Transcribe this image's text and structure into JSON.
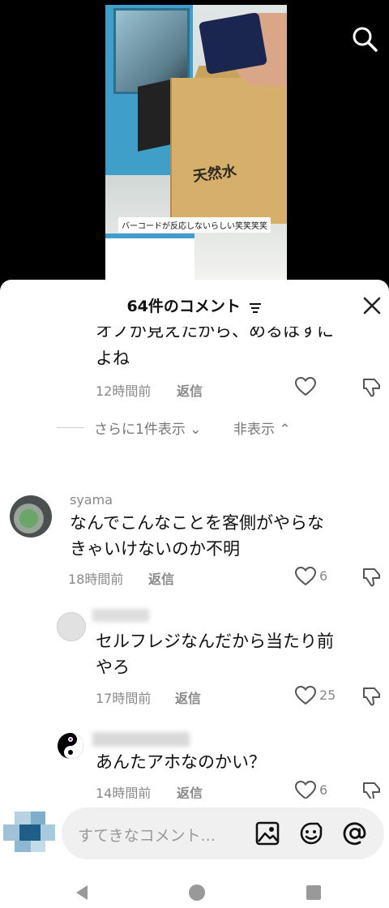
{
  "video": {
    "caption": "バーコードが反応しないらしい笑笑笑笑",
    "box_label": "天然水"
  },
  "sheet": {
    "title": "64件のコメント"
  },
  "comments": {
    "partial": {
      "text_line1": "オノが見えたから、めるはすに",
      "text_line2": "よね",
      "time": "12時間前",
      "reply": "返信"
    },
    "more": {
      "show_more": "さらに1件表示",
      "hide": "非表示"
    },
    "items": [
      {
        "username": "syama",
        "line1": "なんでこんなことを客側がやらな",
        "line2": "きゃいけないのか不明",
        "time": "18時間前",
        "reply": "返信",
        "likes": "6"
      },
      {
        "username": "",
        "line1": "セルフレジなんだから当たり前",
        "line2": "やろ",
        "time": "17時間前",
        "reply": "返信",
        "likes": "25"
      },
      {
        "username": "",
        "line1": "あんたアホなのかい？",
        "time": "14時間前",
        "reply": "返信",
        "likes": "6"
      }
    ],
    "partial_bottom_username": "レー"
  },
  "input": {
    "placeholder": "すてきなコメント..."
  },
  "icons": {
    "search": "search-icon",
    "close": "close-icon",
    "filter": "filter-icon",
    "heart": "heart-icon",
    "dislike": "dislike-icon",
    "image": "image-icon",
    "emoji": "emoji-icon",
    "mention": "at-icon",
    "nav_back": "back-triangle-icon",
    "nav_home": "home-circle-icon",
    "nav_recents": "recents-square-icon"
  }
}
